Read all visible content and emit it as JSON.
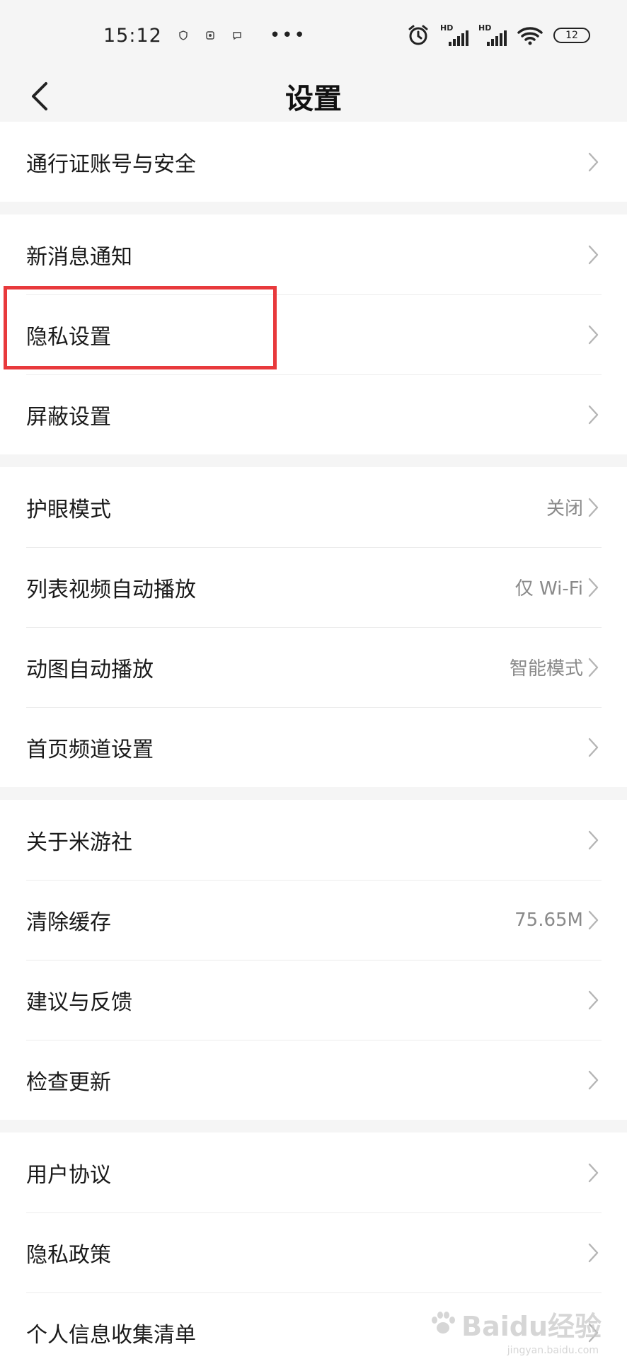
{
  "status_bar": {
    "time": "15:12",
    "battery": "12",
    "hd1": "HD",
    "hd2": "HD",
    "more": "•••"
  },
  "header": {
    "title": "设置"
  },
  "groups": [
    {
      "items": [
        {
          "label": "通行证账号与安全",
          "value": ""
        }
      ]
    },
    {
      "items": [
        {
          "label": "新消息通知",
          "value": ""
        },
        {
          "label": "隐私设置",
          "value": ""
        },
        {
          "label": "屏蔽设置",
          "value": ""
        }
      ]
    },
    {
      "items": [
        {
          "label": "护眼模式",
          "value": "关闭"
        },
        {
          "label": "列表视频自动播放",
          "value": "仅 Wi-Fi"
        },
        {
          "label": "动图自动播放",
          "value": "智能模式"
        },
        {
          "label": "首页频道设置",
          "value": ""
        }
      ]
    },
    {
      "items": [
        {
          "label": "关于米游社",
          "value": ""
        },
        {
          "label": "清除缓存",
          "value": "75.65M"
        },
        {
          "label": "建议与反馈",
          "value": ""
        },
        {
          "label": "检查更新",
          "value": ""
        }
      ]
    },
    {
      "items": [
        {
          "label": "用户协议",
          "value": ""
        },
        {
          "label": "隐私政策",
          "value": ""
        },
        {
          "label": "个人信息收集清单",
          "value": ""
        }
      ]
    }
  ],
  "watermark": {
    "brand": "Baidu经验",
    "url": "jingyan.baidu.com"
  },
  "colors": {
    "highlight": "#e8393c",
    "background": "#f5f5f5",
    "value_text": "#8a8a8a"
  }
}
